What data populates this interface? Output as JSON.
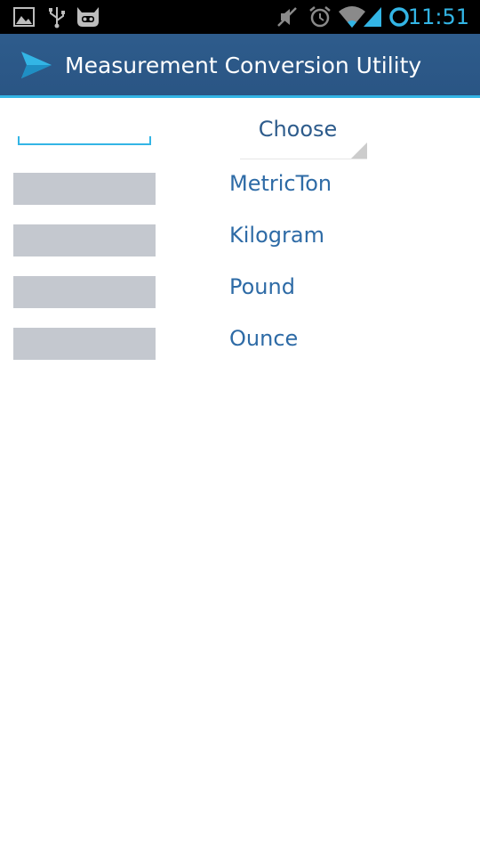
{
  "status_bar": {
    "time": "11:51",
    "icons": [
      "gallery-icon",
      "usb-icon",
      "cyanogen-icon",
      "mute-icon",
      "alarm-icon",
      "wifi-icon",
      "signal-icon",
      "ring-icon"
    ],
    "accent_color": "#33b5e5"
  },
  "app": {
    "title": "Measurement Conversion Utility",
    "icon": "send-arrow-icon",
    "bar_color": "#2e5c8c"
  },
  "converter": {
    "input_value": "",
    "spinner_label": "Choose",
    "units": [
      {
        "label": "MetricTon",
        "result": ""
      },
      {
        "label": "Kilogram",
        "result": ""
      },
      {
        "label": "Pound",
        "result": ""
      },
      {
        "label": "Ounce",
        "result": ""
      }
    ]
  }
}
